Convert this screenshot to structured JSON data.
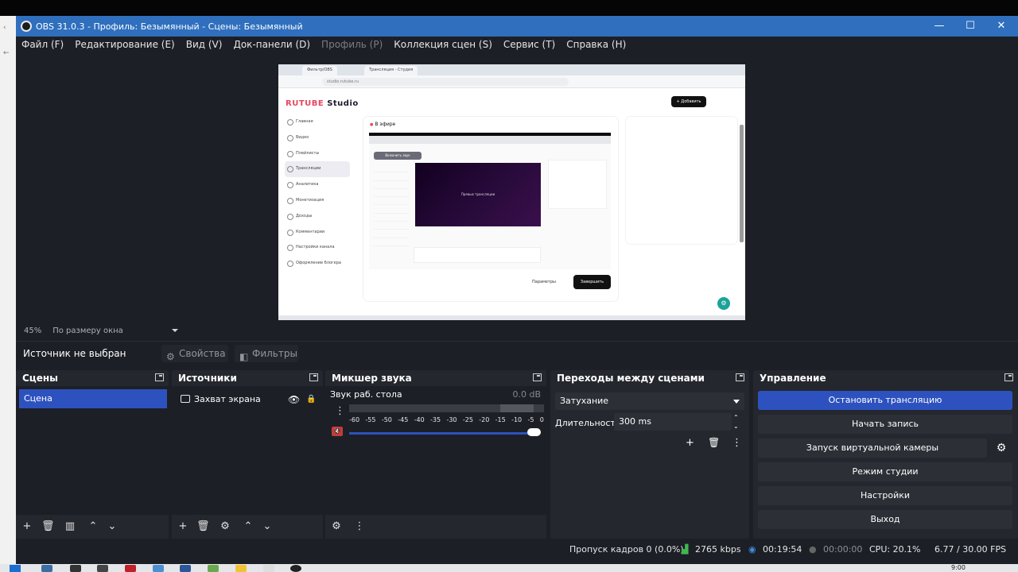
{
  "window": {
    "title": "OBS 31.0.3 - Профиль: Безымянный - Сцены: Безымянный",
    "minimize": "—",
    "maximize": "☐",
    "close": "✕"
  },
  "menu": [
    {
      "label": "Файл (F)",
      "enabled": true
    },
    {
      "label": "Редактирование (E)",
      "enabled": true
    },
    {
      "label": "Вид (V)",
      "enabled": true
    },
    {
      "label": "Док-панели (D)",
      "enabled": true
    },
    {
      "label": "Профиль (P)",
      "enabled": false
    },
    {
      "label": "Коллекция сцен (S)",
      "enabled": true
    },
    {
      "label": "Сервис (T)",
      "enabled": true
    },
    {
      "label": "Справка (H)",
      "enabled": true
    }
  ],
  "preview": {
    "tab1": "Фильтр/OBS",
    "tab2": "Трансляция - Студия",
    "url": "studio.rutube.ru",
    "brand": "RUTUBE",
    "brand_suffix": "Studio",
    "add_button": "+ Добавить",
    "sidebar": [
      "Главная",
      "Видео",
      "Плейлисты",
      "Трансляции",
      "Аналитика",
      "Монетизация",
      "Доходы",
      "Комментарии",
      "Настройки канала",
      "Оформление блогера"
    ],
    "sidebar_selected": 3,
    "live_header": "В эфире",
    "inner_pill": "Включить звук",
    "inner_video": "Превью трансляции",
    "btn_settings": "Параметры",
    "btn_finish": "Завершить",
    "fab": "⚙"
  },
  "zoom": {
    "percent": "45%",
    "mode": "По размеру окна"
  },
  "context": {
    "no_source": "Источник не выбран",
    "properties": "Свойства",
    "filters": "Фильтры"
  },
  "docks": {
    "scenes": {
      "title": "Сцены",
      "items": [
        "Сцена"
      ]
    },
    "sources": {
      "title": "Источники",
      "items": [
        "Захват экрана"
      ]
    },
    "mixer": {
      "title": "Микшер звука",
      "channel": "Звук раб. стола",
      "db": "0.0 dB",
      "ticks": [
        "-60",
        "-55",
        "-50",
        "-45",
        "-40",
        "-35",
        "-30",
        "-25",
        "-20",
        "-15",
        "-10",
        "-5",
        "0"
      ],
      "volume_fraction": 1.0
    },
    "transitions": {
      "title": "Переходы между сценами",
      "selected": "Затухание",
      "duration_label": "Длительность",
      "duration_value": "300 ms"
    },
    "controls": {
      "title": "Управление",
      "buttons": [
        {
          "label": "Остановить трансляцию",
          "active": true
        },
        {
          "label": "Начать запись",
          "active": false
        },
        {
          "label": "Запуск виртуальной камеры",
          "active": false
        },
        {
          "label": "Режим студии",
          "active": false
        },
        {
          "label": "Настройки",
          "active": false
        },
        {
          "label": "Выход",
          "active": false
        }
      ]
    }
  },
  "status": {
    "dropped": "Пропуск кадров 0 (0.0%)",
    "bitrate": "2765 kbps",
    "stream_time": "00:19:54",
    "rec_time": "00:00:00",
    "cpu": "CPU: 20.1%",
    "fps": "6.77 / 30.00 FPS"
  },
  "taskbar": {
    "clock": "9:00"
  },
  "colors": {
    "titlebar": "#2f6fbe",
    "accent": "#2d52bf",
    "panel": "#25272e",
    "background": "#1d1f26"
  }
}
